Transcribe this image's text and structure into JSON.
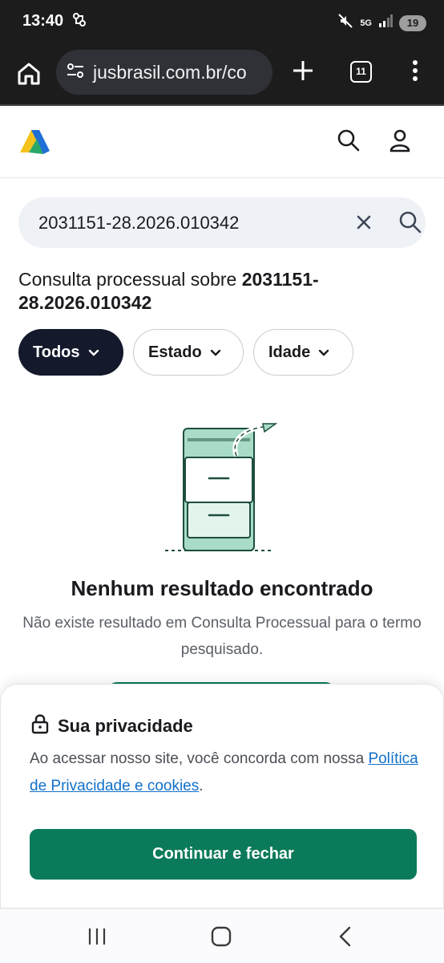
{
  "status_bar": {
    "time": "13:40",
    "network": "5G",
    "battery": "19"
  },
  "browser": {
    "url": "jusbrasil.com.br/co",
    "tab_count": "11"
  },
  "search": {
    "value": "2031151-28.2026.010342"
  },
  "heading": {
    "prefix": "Consulta processual sobre ",
    "query": "2031151-28.2026.010342"
  },
  "filters": [
    {
      "label": "Todos",
      "active": true
    },
    {
      "label": "Estado",
      "active": false
    },
    {
      "label": "Idade",
      "active": false
    }
  ],
  "empty_state": {
    "title": "Nenhum resultado encontrado",
    "description": "Não existe resultado em Consulta Processual para o termo pesquisado."
  },
  "privacy": {
    "title": "Sua privacidade",
    "text": "Ao acessar nosso site, você concorda com nossa ",
    "link": "Política de Privacidade e cookies",
    "text_end": ".",
    "button": "Continuar e fechar"
  },
  "colors": {
    "primary_green": "#0b7a5a",
    "dark_chip": "#141a2b",
    "link_blue": "#1170c9",
    "illustration_mint": "#a8dcc6"
  }
}
